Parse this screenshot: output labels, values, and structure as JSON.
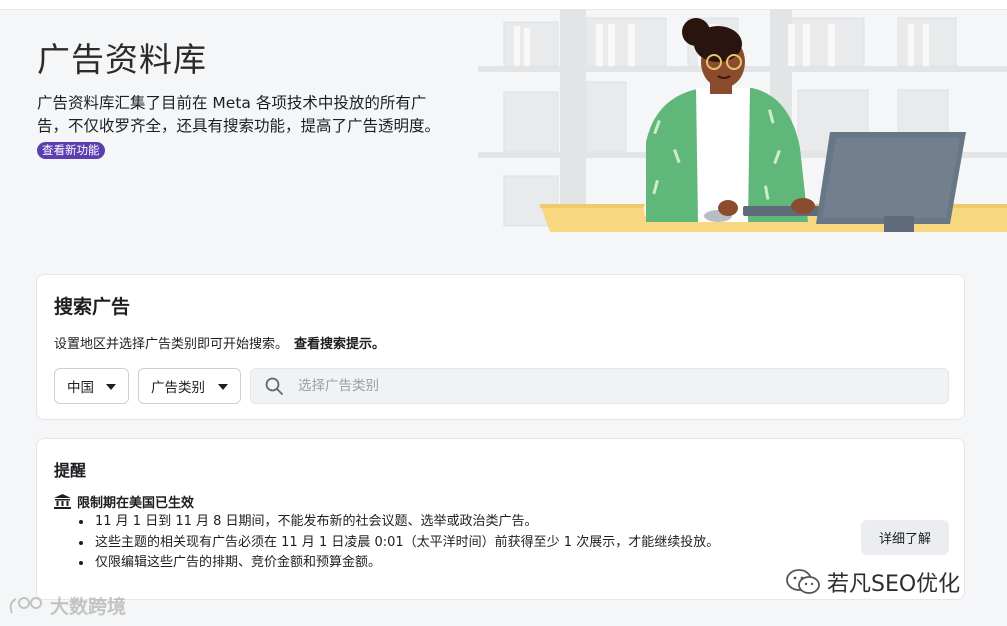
{
  "hero": {
    "title": "广告资料库",
    "description": "广告资料库汇集了目前在 Meta 各项技术中投放的所有广告，不仅收罗齐全，还具有搜索功能，提高了广告透明度。",
    "new_badge": "查看新功能"
  },
  "search": {
    "title": "搜索广告",
    "description": "设置地区并选择广告类别即可开始搜索。",
    "tips_link": "查看搜索提示。",
    "country_value": "中国",
    "category_value": "广告类别",
    "placeholder": "选择广告类别"
  },
  "reminder": {
    "title": "提醒",
    "heading": "限制期在美国已生效",
    "items": [
      "11 月 1 日到 11 月 8 日期间，不能发布新的社会议题、选举或政治类广告。",
      "这些主题的相关现有广告必须在 11 月 1 日凌晨 0:01（太平洋时间）前获得至少 1 次展示，才能继续投放。",
      "仅限编辑这些广告的排期、竞价金额和预算金额。"
    ],
    "detail_button": "详细了解"
  },
  "watermarks": {
    "right_text": "若凡SEO优化",
    "left_text": "大数跨境"
  },
  "colors": {
    "badge_purple": "#5b3fb0",
    "card_border": "#e4e6e9",
    "search_bg": "#f0f2f5"
  }
}
